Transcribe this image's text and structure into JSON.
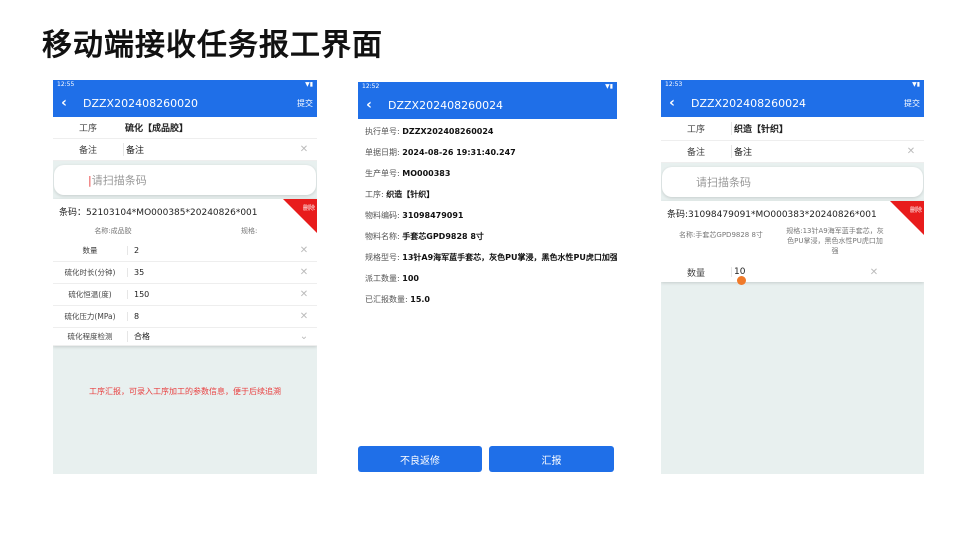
{
  "slide_title": "移动端接收任务报工界面",
  "icons": {
    "back": "chevron-left-icon",
    "clear": "close-icon",
    "dropdown": "chevron-down-icon"
  },
  "colors": {
    "primary": "#1f6fe8",
    "danger": "#e81c1c",
    "hint": "#e84040",
    "cursor_dot": "#f07a2a"
  },
  "p1": {
    "status_time": "12:55",
    "title": "DZZX202408260020",
    "submit": "提交",
    "process_label": "工序",
    "process_value": "硫化【成品胶】",
    "remark_label": "备注",
    "remark_placeholder": "备注",
    "scan_placeholder": "请扫描条码",
    "barcode": "条码：52103104*MO000385*20240826*001",
    "delete": "删除",
    "name": "名称:成品胶",
    "spec": "规格:",
    "params": [
      {
        "label": "数量",
        "value": "2"
      },
      {
        "label": "硫化时长(分钟)",
        "value": "35"
      },
      {
        "label": "硫化恒温(度)",
        "value": "150"
      },
      {
        "label": "硫化压力(MPa)",
        "value": "8"
      },
      {
        "label": "硫化程度检测",
        "value": "合格"
      }
    ],
    "hint": "工序汇报，可录入工序加工的参数信息，便于后续追溯"
  },
  "p2": {
    "status_time": "12:52",
    "title": "DZZX202408260024",
    "fields": [
      {
        "label": "执行单号: ",
        "value": "DZZX202408260024"
      },
      {
        "label": "单据日期: ",
        "value": "2024-08-26 19:31:40.247"
      },
      {
        "label": "生产单号: ",
        "value": "MO000383"
      },
      {
        "label": "工序: ",
        "value": "织造【针织】"
      },
      {
        "label": "物料编码: ",
        "value": "31098479091"
      },
      {
        "label": "物料名称: ",
        "value": "手套芯GPD9828 8寸"
      },
      {
        "label": "规格型号: ",
        "value": "13针A9海军蓝手套芯，灰色PU掌浸，黑色水性PU虎口加强"
      },
      {
        "label": "派工数量: ",
        "value": "100"
      },
      {
        "label": "已汇报数量: ",
        "value": "15.0"
      }
    ],
    "btn_bad": "不良返修",
    "btn_report": "汇报"
  },
  "p3": {
    "status_time": "12:53",
    "title": "DZZX202408260024",
    "submit": "提交",
    "process_label": "工序",
    "process_value": "织造【针织】",
    "remark_label": "备注",
    "remark_placeholder": "备注",
    "scan_placeholder": "请扫描条码",
    "barcode": "条码:31098479091*MO000383*20240826*001",
    "delete": "删除",
    "name": "名称:手套芯GPD9828 8寸",
    "spec": "规格:13针A9海军蓝手套芯，灰色PU掌浸，黑色水性PU虎口加强",
    "qty_label": "数量",
    "qty_value": "10"
  }
}
